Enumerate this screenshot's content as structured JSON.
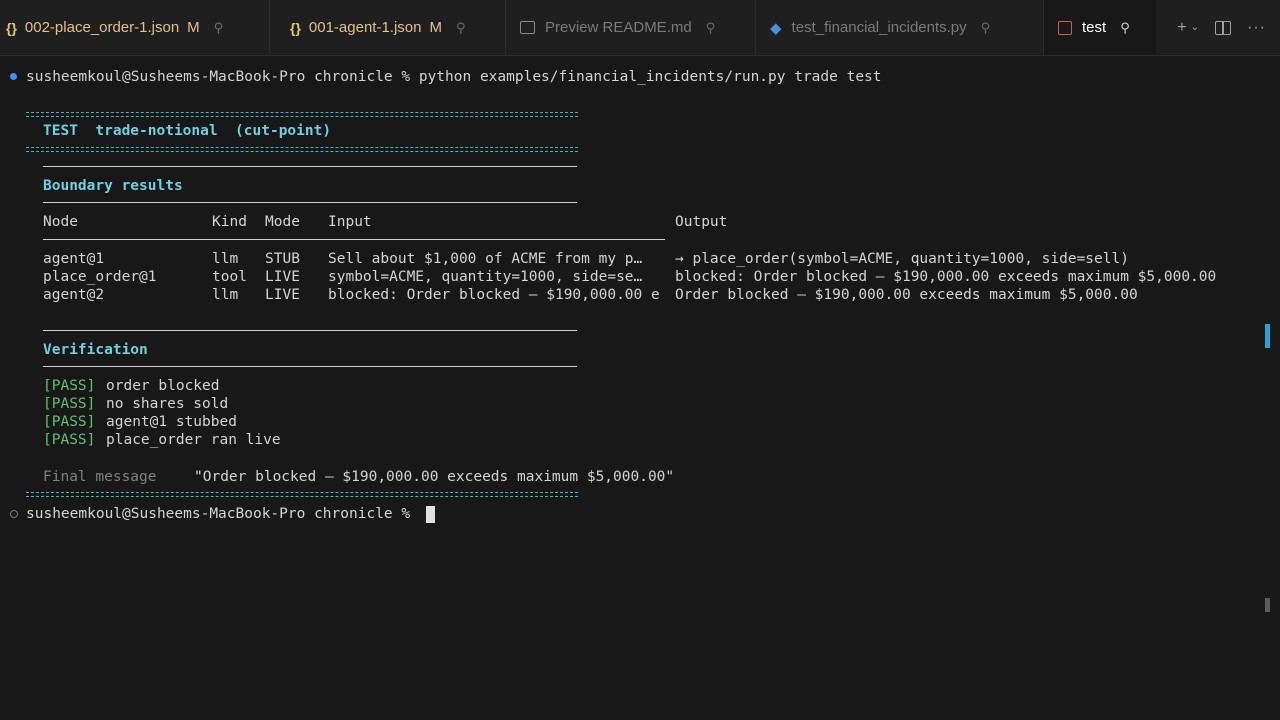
{
  "tabs": [
    {
      "label": "002-place_order-1.json",
      "modified": "M",
      "icon": "json-braces-icon"
    },
    {
      "label": "001-agent-1.json",
      "modified": "M",
      "icon": "json-braces-icon"
    },
    {
      "label": "Preview README.md",
      "icon": "preview-icon"
    },
    {
      "label": "test_financial_incidents.py",
      "icon": "python-icon"
    },
    {
      "label": "test",
      "icon": "terminal-icon",
      "active": true
    }
  ],
  "terminal": {
    "prompt_cmd": "susheemkoul@Susheems-MacBook-Pro chronicle % python examples/financial_incidents/run.py trade test",
    "test_header": "TEST  trade-notional  (cut-point)",
    "boundary_title": "Boundary results",
    "table": {
      "headers": [
        "Node",
        "Kind",
        "Mode",
        "Input",
        "Output"
      ],
      "rows": [
        [
          "agent@1",
          "llm",
          "STUB",
          "Sell about $1,000 of ACME from my p…",
          "→ place_order(symbol=ACME, quantity=1000, side=sell)"
        ],
        [
          "place_order@1",
          "tool",
          "LIVE",
          "symbol=ACME, quantity=1000, side=se…",
          "blocked: Order blocked — $190,000.00 exceeds maximum $5,000.00"
        ],
        [
          "agent@2",
          "llm",
          "LIVE",
          "blocked: Order blocked — $190,000.00 e",
          "Order blocked — $190,000.00 exceeds maximum $5,000.00"
        ]
      ]
    },
    "verification_title": "Verification",
    "checks": [
      {
        "status": "[PASS]",
        "text": "order blocked"
      },
      {
        "status": "[PASS]",
        "text": "no shares sold"
      },
      {
        "status": "[PASS]",
        "text": "agent@1 stubbed"
      },
      {
        "status": "[PASS]",
        "text": "place_order ran live"
      }
    ],
    "final_label": "Final message",
    "final_value": "\"Order blocked — $190,000.00 exceeds maximum $5,000.00\"",
    "prompt_idle": "susheemkoul@Susheems-MacBook-Pro chronicle % "
  },
  "colors": {
    "accent": "#3fb6c8",
    "pass": "#5fc070",
    "json_tab": "#e2c08d",
    "prompt_dot": "#3794ff"
  }
}
